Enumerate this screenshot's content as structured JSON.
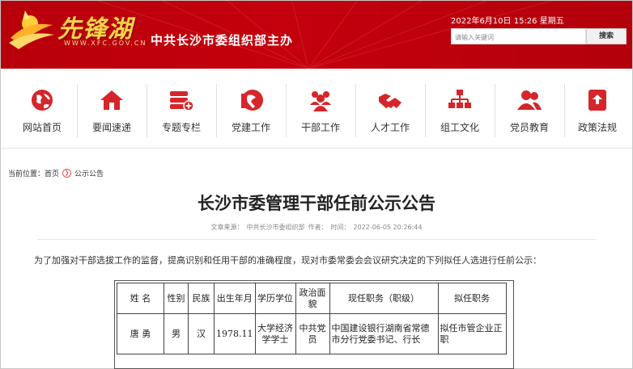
{
  "header": {
    "logo_text": "先锋湖",
    "logo_url": "WWW.XFC.GOV.CN",
    "sponsor": "中共长沙市委组织部主办",
    "datetime": "2022年6月10日 15:26 星期五",
    "search_placeholder": "请输入关键词",
    "search_button": "搜索",
    "colors": {
      "banner": "#c4000d",
      "logo": "#ffd34a"
    }
  },
  "nav": {
    "items": [
      {
        "label": "网站首页",
        "icon": "globe-icon"
      },
      {
        "label": "要闻速递",
        "icon": "home-icon"
      },
      {
        "label": "专题专栏",
        "icon": "server-plus-icon"
      },
      {
        "label": "党建工作",
        "icon": "party-icon"
      },
      {
        "label": "干部工作",
        "icon": "group-icon"
      },
      {
        "label": "人才工作",
        "icon": "handshake-icon"
      },
      {
        "label": "组工文化",
        "icon": "org-chart-icon"
      },
      {
        "label": "党员教育",
        "icon": "users-icon"
      },
      {
        "label": "政策法规",
        "icon": "document-upload-icon"
      }
    ],
    "icon_color": "#d6252b"
  },
  "breadcrumb": {
    "prefix": "当前位置：",
    "home": "首页",
    "current": "公示公告"
  },
  "article": {
    "title": "长沙市委管理干部任前公示公告",
    "source_label": "文章来源：",
    "source": "中共长沙市委组织部",
    "author_label": "作者：",
    "time_label": "时间：",
    "time": "2022-06-05 20:26:44",
    "intro": "为了加强对干部选拔工作的监督，提高识别和任用干部的准确程度，现对市委常委会会议研究决定的下列拟任人选进行任前公示："
  },
  "table": {
    "headers": [
      "姓  名",
      "性别",
      "民族",
      "出生年月",
      "学历学位",
      "政治面貌",
      "现任职务（职级）",
      "拟任职务"
    ],
    "rows": [
      [
        "唐  勇",
        "男",
        "汉",
        "1978.11",
        "大学经济学学士",
        "中共党员",
        "中国建设银行湖南省常德市分行党委书记、行长",
        "拟任市管企业正职"
      ]
    ]
  }
}
